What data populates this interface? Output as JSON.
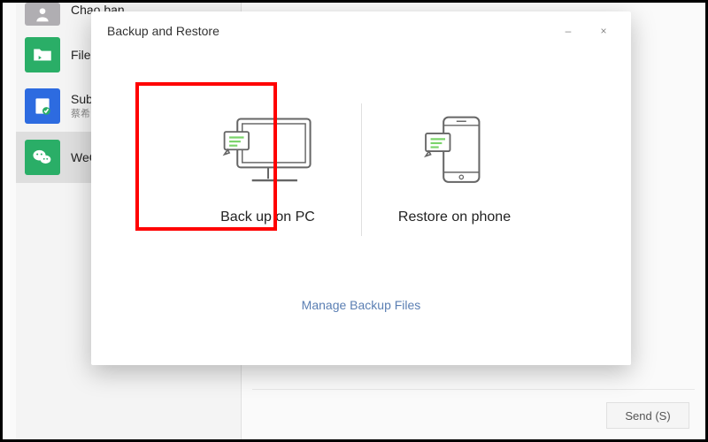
{
  "sidebar": {
    "items": [
      {
        "title": "Chao ban",
        "sub": ""
      },
      {
        "title": "File Transfer",
        "sub": ""
      },
      {
        "title": "Subscriptions",
        "sub": "蔡希: 你好"
      },
      {
        "title": "WeChat",
        "sub": ""
      }
    ]
  },
  "dialog": {
    "title": "Backup and Restore",
    "options": {
      "backup": "Back up on PC",
      "restore": "Restore on phone"
    },
    "manage_link": "Manage Backup Files",
    "minimize": "–",
    "close": "×"
  },
  "chat": {
    "send_label": "Send (S)"
  }
}
